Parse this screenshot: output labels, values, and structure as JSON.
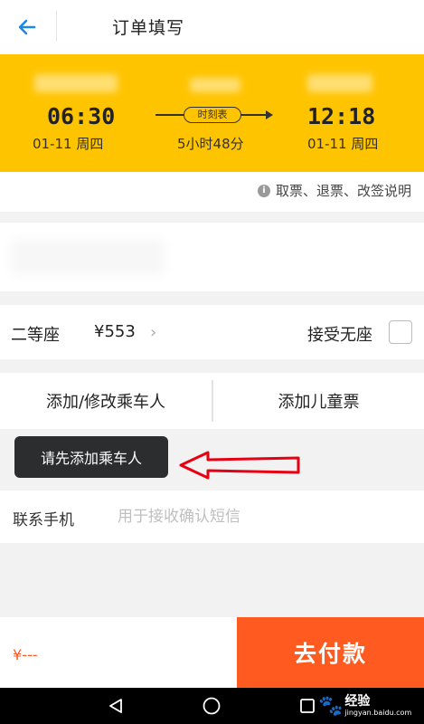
{
  "header": {
    "title": "订单填写"
  },
  "train": {
    "departure_time": "06:30",
    "departure_date": "01-11  周四",
    "arrival_time": "12:18",
    "arrival_date": "01-11  周四",
    "timetable_label": "时刻表",
    "duration": "5小时48分"
  },
  "policy": {
    "link_text": "取票、退票、改签说明",
    "icon": "info-icon"
  },
  "seat": {
    "type": "二等座",
    "price": "¥553",
    "accept_no_seat_label": "接受无座",
    "accept_no_seat_checked": false
  },
  "passengers": {
    "add_edit_label": "添加/修改乘车人",
    "add_child_label": "添加儿童票"
  },
  "toast": {
    "message": "请先添加乘车人"
  },
  "contact": {
    "phone_label": "联系手机",
    "phone_value": "",
    "phone_placeholder": "用于接收确认短信"
  },
  "footer": {
    "total_price": "¥---",
    "pay_label": "去付款"
  },
  "watermark": {
    "logo": "Bai",
    "name": "经验",
    "url": "jingyan.baidu.com"
  },
  "colors": {
    "panel_yellow": "#ffc400",
    "pay_orange": "#ff5a1f",
    "back_blue": "#1e88e5",
    "annotation_red": "#e60012"
  }
}
